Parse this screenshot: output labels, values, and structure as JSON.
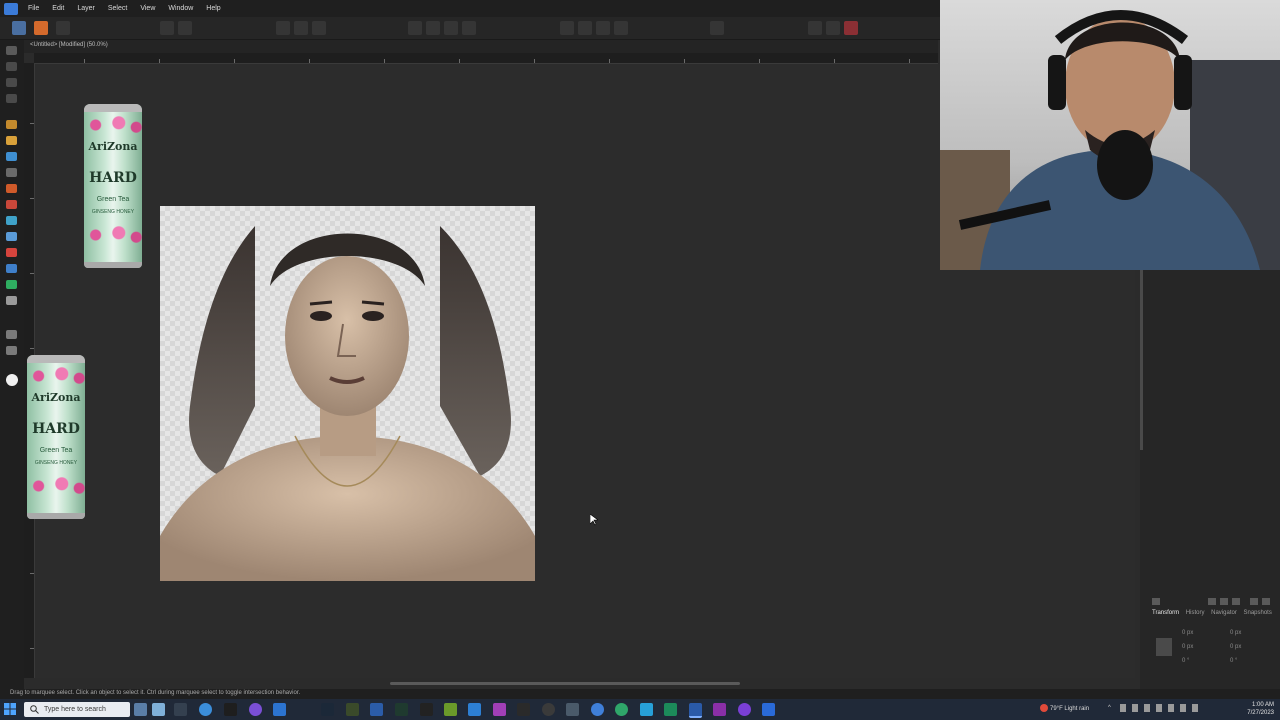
{
  "menu": {
    "items": [
      "File",
      "Edit",
      "Layer",
      "Select",
      "View",
      "Window",
      "Help"
    ]
  },
  "document": {
    "tab_title": "<Untitled> [Modified] (50.0%)"
  },
  "canvas": {
    "can_top": {
      "brand": "AriZona",
      "line1": "HARD",
      "line2": "Green Tea",
      "line3": "GINSENG HONEY"
    },
    "can_bottom": {
      "brand": "AriZona",
      "line1": "HARD",
      "line2": "Green Tea",
      "line3": "GINSENG HONEY"
    }
  },
  "right_panel": {
    "tabs": [
      "Transform",
      "History",
      "Navigator",
      "Snapshots"
    ],
    "selected_tab": "Transform",
    "values": [
      "0 px",
      "0 px",
      "0 px",
      "0 px",
      "0 °",
      "0 °"
    ]
  },
  "status_bar": {
    "text": "Drag to marquee select. Click an object to select it. Ctrl during marquee select to toggle intersection behavior."
  },
  "taskbar": {
    "search_placeholder": "Type here to search",
    "weather": "79°F  Light rain",
    "time": "1:00 AM",
    "date": "7/27/2023"
  },
  "colors": {
    "accent": "#4a6fa1",
    "canvas_bg": "#2c2c2c",
    "taskbar_bg": "#202938"
  }
}
